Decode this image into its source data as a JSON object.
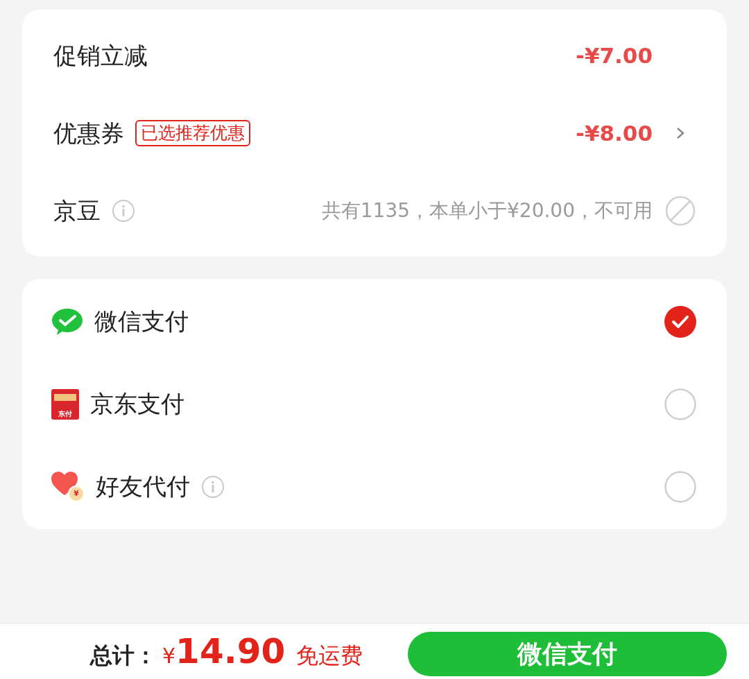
{
  "discounts": [
    {
      "label": "促销立减",
      "value": "-¥7.00",
      "kind": "amount"
    },
    {
      "label": "优惠券",
      "badge": "已选推荐优惠",
      "value": "-¥8.00",
      "kind": "link"
    },
    {
      "label": "京豆",
      "info": true,
      "value": "共有1135，本单小于¥20.00，不可用",
      "kind": "disabled"
    }
  ],
  "payment_methods": [
    {
      "name": "微信支付",
      "kind": "wechat",
      "info": false,
      "selected": true
    },
    {
      "name": "京东支付",
      "kind": "jdpay",
      "icon_text": "东付",
      "info": false,
      "selected": false
    },
    {
      "name": "好友代付",
      "kind": "friend",
      "icon_text": "¥",
      "info": true,
      "selected": false
    }
  ],
  "footer": {
    "total_label": "总计：",
    "currency": "¥",
    "amount": "14.90",
    "shipping": "免运费",
    "pay_button": "微信支付"
  }
}
